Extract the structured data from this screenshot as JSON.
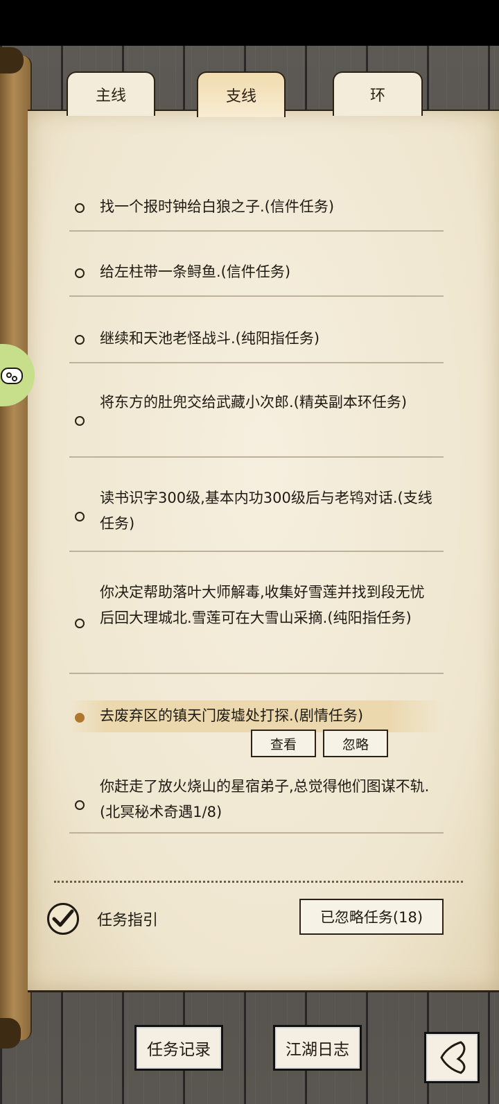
{
  "tabs": [
    {
      "label": "主线",
      "active": false
    },
    {
      "label": "支线",
      "active": true
    },
    {
      "label": "环",
      "active": false
    }
  ],
  "quests": [
    {
      "text": "找一个报时钟给白狼之子.(信件任务)"
    },
    {
      "text": "给左柱带一条鲟鱼.(信件任务)"
    },
    {
      "text": "继续和天池老怪战斗.(纯阳指任务)"
    },
    {
      "text": "将东方的肚兜交给武藏小次郎.(精英副本环任务)"
    },
    {
      "text": "读书识字300级,基本内功300级后与老鸨对话.(支线任务)"
    },
    {
      "text": "你决定帮助落叶大师解毒,收集好雪莲并找到段无忧后回大理城北.雪莲可在大雪山采摘.(纯阳指任务)"
    },
    {
      "text": "去废弃区的镇天门废墟处打探.(剧情任务)",
      "selected": true
    },
    {
      "text": "你赶走了放火烧山的星宿弟子,总觉得他们图谋不轨.(北冥秘术奇遇1/8)"
    }
  ],
  "quest_actions": {
    "view": "查看",
    "ignore": "忽略"
  },
  "guide": {
    "label": "任务指引",
    "checked": true
  },
  "ignored_button": "已忽略任务(18)",
  "bottom_nav": {
    "records": "任务记录",
    "journal": "江湖日志"
  },
  "icons": {
    "back": "back-arrow-icon",
    "float": "gamepad-icon",
    "check": "checkmark-icon"
  },
  "colors": {
    "paper": "#efe6cf",
    "ink": "#1f1a12",
    "selected_bullet": "#b0782e",
    "float_bubble": "#c7de8a"
  }
}
